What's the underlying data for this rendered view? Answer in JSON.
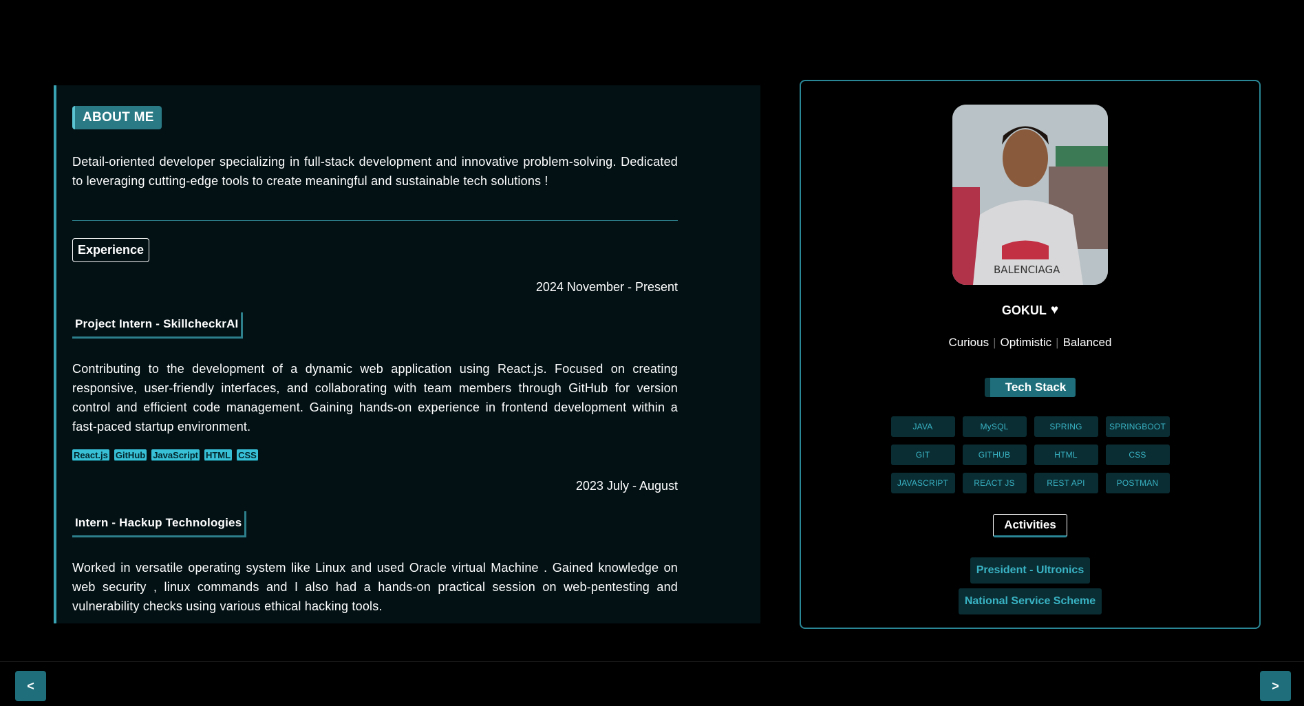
{
  "about": {
    "badge": "ABOUT ME",
    "text": "Detail-oriented developer specializing in full-stack development and innovative problem-solving. Dedicated to leveraging cutting-edge tools to create meaningful and sustainable tech solutions !"
  },
  "experience": {
    "badge": "Experience",
    "jobs": [
      {
        "date": "2024 November - Present",
        "title": "Project Intern - SkillcheckrAI",
        "description": "Contributing to the development of a dynamic web application using React.js. Focused on creating responsive, user-friendly interfaces, and collaborating with team members through GitHub for version control and efficient code management. Gaining hands-on experience in frontend development within a fast-paced startup environment.",
        "skills": [
          "React.js",
          "GitHub",
          "JavaScript",
          "HTML",
          "CSS"
        ]
      },
      {
        "date": "2023 July - August",
        "title": "Intern - Hackup Technologies",
        "description": "Worked in versatile operating system like Linux and used Oracle virtual Machine . Gained knowledge on web security , linux commands and I also had a hands-on practical session on web-pentesting and vulnerability checks using various ethical hacking tools."
      }
    ]
  },
  "profile": {
    "name": "GOKUL",
    "name_icon": "heart-icon",
    "traits": [
      "Curious",
      "Optimistic",
      "Balanced"
    ],
    "tech_stack_title": "Tech Stack",
    "tech_stack": [
      "JAVA",
      "MySQL",
      "SPRING",
      "SPRINGBOOT",
      "GIT",
      "GITHUB",
      "HTML",
      "CSS",
      "JAVASCRIPT",
      "REACT JS",
      "REST API",
      "POSTMAN"
    ],
    "activities_title": "Activities",
    "activities": [
      "President - Ultronics",
      "National Service Scheme"
    ]
  },
  "nav": {
    "prev_label": "<",
    "next_label": ">"
  },
  "colors": {
    "accent": "#2a7a86",
    "accent_light": "#38c0d6",
    "panel_bg": "#031115"
  }
}
